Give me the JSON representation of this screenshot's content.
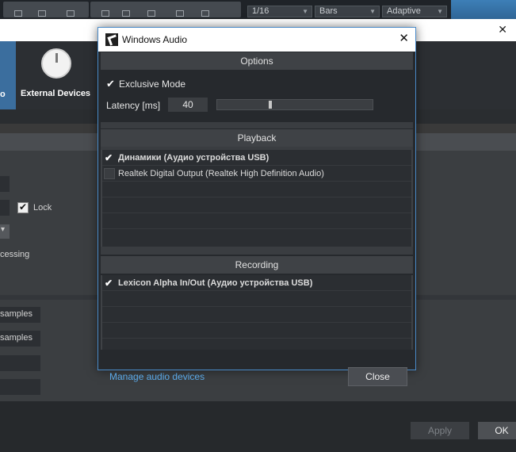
{
  "bg": {
    "toolbar": {
      "quantize": "1/16",
      "timebase": "Bars",
      "snap": "Adaptive"
    },
    "categories": {
      "current_partial": "o",
      "external_devices": "External Devices"
    },
    "settings": {
      "lock_label": "Lock",
      "processing_partial": "cessing",
      "samples_1": "samples",
      "samples_2": "samples"
    },
    "footer": {
      "apply": "Apply",
      "ok": "OK"
    }
  },
  "dialog": {
    "title": "Windows Audio",
    "options": {
      "header": "Options",
      "exclusive_mode": "Exclusive Mode",
      "latency_label": "Latency [ms]",
      "latency_value": "40",
      "latency_slider_fraction": 0.34
    },
    "playback": {
      "header": "Playback",
      "devices": [
        {
          "name": "Динамики (Аудио устройства USB)",
          "checked": true
        },
        {
          "name": "Realtek Digital Output (Realtek High Definition Audio)",
          "checked": false
        }
      ]
    },
    "recording": {
      "header": "Recording",
      "devices": [
        {
          "name": "Lexicon Alpha In/Out (Аудио устройства USB)",
          "checked": true
        }
      ]
    },
    "manage_link": "Manage audio devices",
    "close_button": "Close"
  },
  "colors": {
    "accent_link": "#5aa8e6",
    "dialog_border": "#4a8bc9",
    "category_selected": "#3b6e9e"
  }
}
